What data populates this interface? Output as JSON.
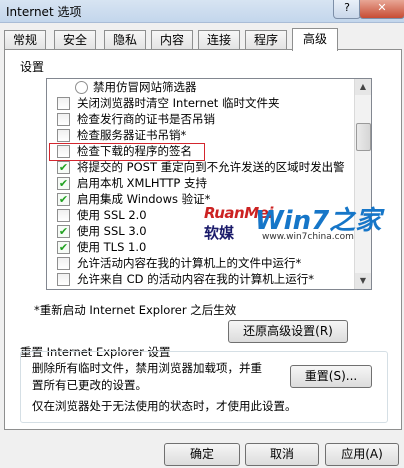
{
  "window": {
    "title": "Internet 选项",
    "help_glyph": "?",
    "close_glyph": "✕"
  },
  "tabs": [
    {
      "label": "常规"
    },
    {
      "label": "安全"
    },
    {
      "label": "隐私"
    },
    {
      "label": "内容"
    },
    {
      "label": "连接"
    },
    {
      "label": "程序"
    },
    {
      "label": "高级",
      "active": true
    }
  ],
  "settings": {
    "label": "设置",
    "items": [
      {
        "type": "radio",
        "checked": false,
        "label": "禁用仿冒网站筛选器"
      },
      {
        "type": "checkbox",
        "checked": false,
        "label": "关闭浏览器时清空 Internet 临时文件夹"
      },
      {
        "type": "checkbox",
        "checked": false,
        "label": "检查发行商的证书是否吊销"
      },
      {
        "type": "checkbox",
        "checked": false,
        "label": "检查服务器证书吊销*"
      },
      {
        "type": "checkbox",
        "checked": false,
        "label": "检查下载的程序的签名",
        "highlighted": true
      },
      {
        "type": "checkbox",
        "checked": true,
        "label": "将提交的 POST 重定向到不允许发送的区域时发出警"
      },
      {
        "type": "checkbox",
        "checked": true,
        "label": "启用本机 XMLHTTP 支持"
      },
      {
        "type": "checkbox",
        "checked": true,
        "label": "启用集成 Windows 验证*"
      },
      {
        "type": "checkbox",
        "checked": false,
        "label": "使用 SSL 2.0"
      },
      {
        "type": "checkbox",
        "checked": true,
        "label": "使用 SSL 3.0"
      },
      {
        "type": "checkbox",
        "checked": true,
        "label": "使用 TLS 1.0"
      },
      {
        "type": "checkbox",
        "checked": false,
        "label": "允许活动内容在我的计算机上的文件中运行*"
      },
      {
        "type": "checkbox",
        "checked": false,
        "label": "允许来自 CD 的活动内容在我的计算机上运行*"
      }
    ],
    "check_glyph": "✔",
    "scroll_up_glyph": "▲",
    "scroll_down_glyph": "▼"
  },
  "restart_note": "*重新启动 Internet Explorer 之后生效",
  "restore_button": "还原高级设置(R)",
  "reset": {
    "group_label": "重置 Internet Explorer 设置",
    "desc_line1": "删除所有临时文件，禁用浏览器加载项，并重",
    "desc_line2": "置所有已更改的设置。",
    "button": "重置(S)...",
    "note": "仅在浏览器处于无法使用的状态时，才使用此设置。"
  },
  "footer": {
    "ok": "确定",
    "cancel": "取消",
    "apply": "应用(A)"
  },
  "watermark": {
    "brand_latin": "RuanMei",
    "brand_cn": "软媒",
    "site_logo": "Win7之家",
    "site_url": "www.win7china.com"
  }
}
